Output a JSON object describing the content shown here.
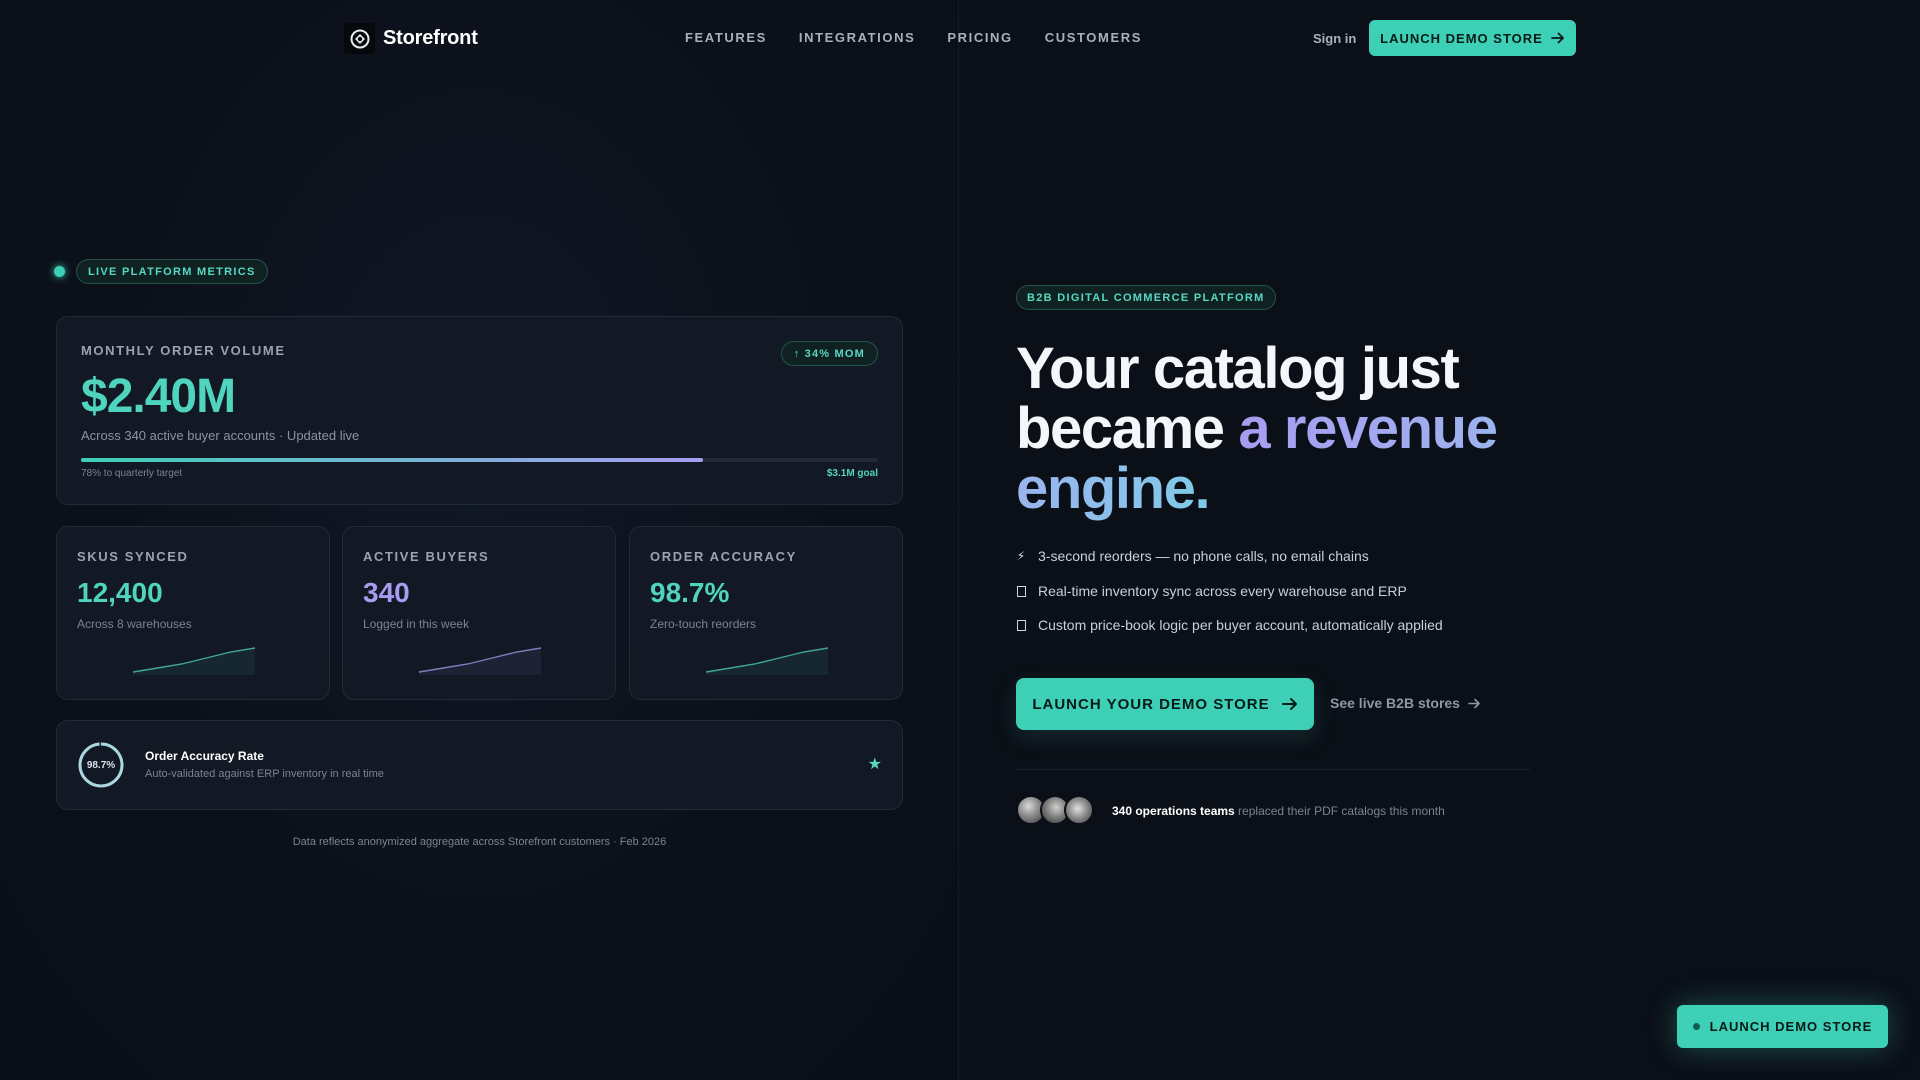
{
  "nav": {
    "brand": "Storefront",
    "links": [
      "FEATURES",
      "INTEGRATIONS",
      "PRICING",
      "CUSTOMERS"
    ],
    "sign_in": "Sign in",
    "cta": "LAUNCH DEMO STORE"
  },
  "metrics": {
    "live_label": "LIVE PLATFORM METRICS",
    "main": {
      "label": "MONTHLY ORDER VOLUME",
      "badge": "↑ 34% MOM",
      "value": "$2.40M",
      "subtitle": "Across 340 active buyer accounts · Updated live",
      "progress_fraction": 0.78,
      "progress_label": "78% to quarterly target",
      "goal_label": "$3.1M goal"
    },
    "stats": [
      {
        "label": "SKUS SYNCED",
        "value": "12,400",
        "sub": "Across 8 warehouses",
        "color": "#4fd4bd",
        "trend": [
          1,
          2,
          3,
          4.5,
          6,
          7
        ]
      },
      {
        "label": "ACTIVE BUYERS",
        "value": "340",
        "sub": "Logged in this week",
        "color": "#a79cf0",
        "trend": [
          1,
          2,
          3,
          4.5,
          6,
          7
        ]
      },
      {
        "label": "ORDER ACCURACY",
        "value": "98.7%",
        "sub": "Zero-touch reorders",
        "color": "#4fd4bd",
        "trend": [
          1,
          2,
          3,
          4.5,
          6,
          7
        ]
      }
    ],
    "accuracy": {
      "ring_value": "98.7%",
      "ring_fraction": 0.987,
      "title": "Order Accuracy Rate",
      "subtitle": "Auto-validated against ERP inventory in real time"
    },
    "footnote": "Data reflects anonymized aggregate across Storefront customers · Feb 2026"
  },
  "hero": {
    "pill": "B2B DIGITAL COMMERCE PLATFORM",
    "headline_plain": "Your catalog just became ",
    "headline_accent": "a revenue engine.",
    "features": [
      "3-second reorders — no phone calls, no email chains",
      "Real-time inventory sync across every warehouse and ERP",
      "Custom price-book logic per buyer account, automatically applied"
    ],
    "cta": "LAUNCH YOUR DEMO STORE",
    "secondary": "See live B2B stores",
    "social_bold": "340 operations teams",
    "social_rest": " replaced their PDF catalogs this month"
  },
  "floating_cta": "LAUNCH DEMO STORE",
  "colors": {
    "accent": "#3ecfb7",
    "accent_text": "#4fd4bd",
    "violet": "#a79cf0",
    "background": "#0b0f17",
    "card": "#121824"
  }
}
